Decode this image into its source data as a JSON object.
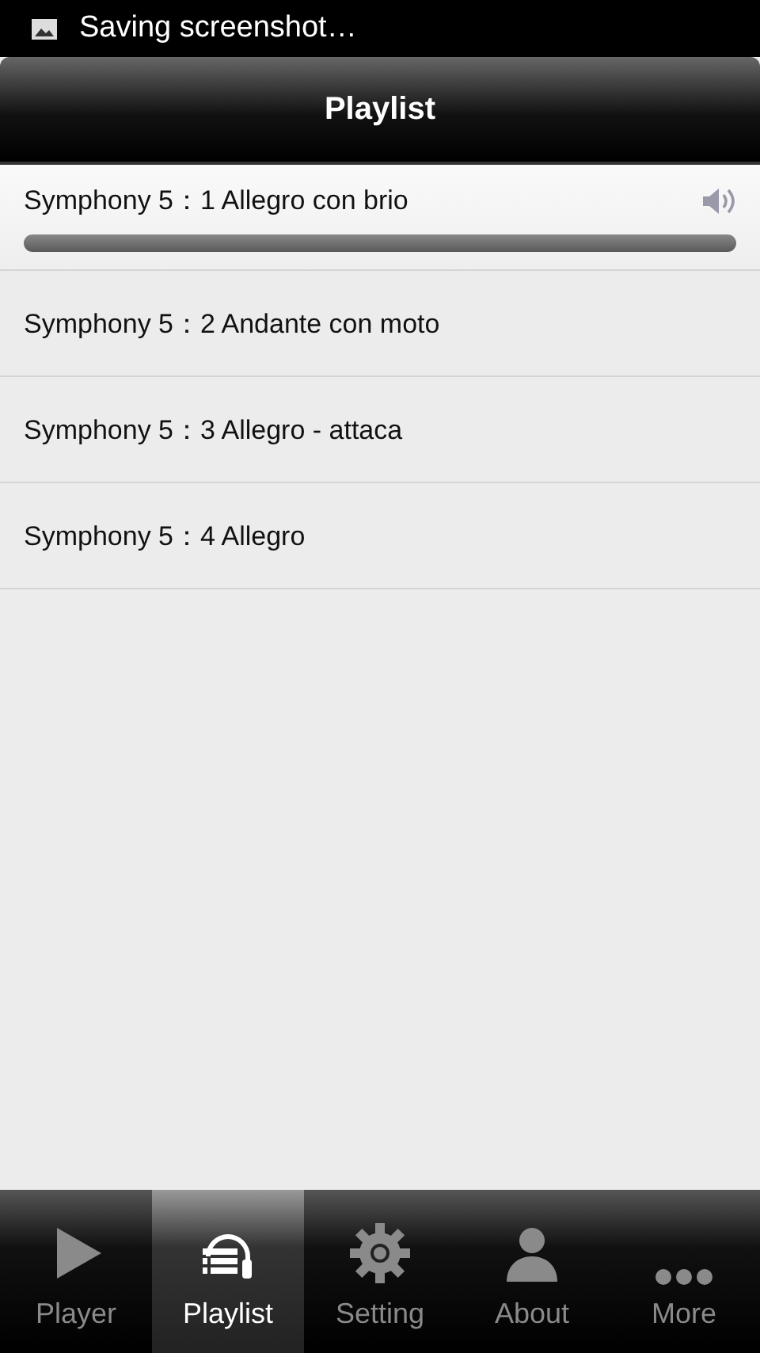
{
  "status_bar": {
    "notification": "Saving screenshot…"
  },
  "header": {
    "title": "Playlist"
  },
  "tracks": [
    {
      "title": "Symphony 5：1 Allegro con brio",
      "playing": true
    },
    {
      "title": "Symphony 5：2 Andante con moto",
      "playing": false
    },
    {
      "title": "Symphony 5：3 Allegro - attaca",
      "playing": false
    },
    {
      "title": "Symphony 5：4 Allegro",
      "playing": false
    }
  ],
  "tabs": [
    {
      "kind": "player",
      "label": "Player",
      "selected": false
    },
    {
      "kind": "playlist",
      "label": "Playlist",
      "selected": true
    },
    {
      "kind": "setting",
      "label": "Setting",
      "selected": false
    },
    {
      "kind": "about",
      "label": "About",
      "selected": false
    },
    {
      "kind": "more",
      "label": "More",
      "selected": false
    }
  ]
}
